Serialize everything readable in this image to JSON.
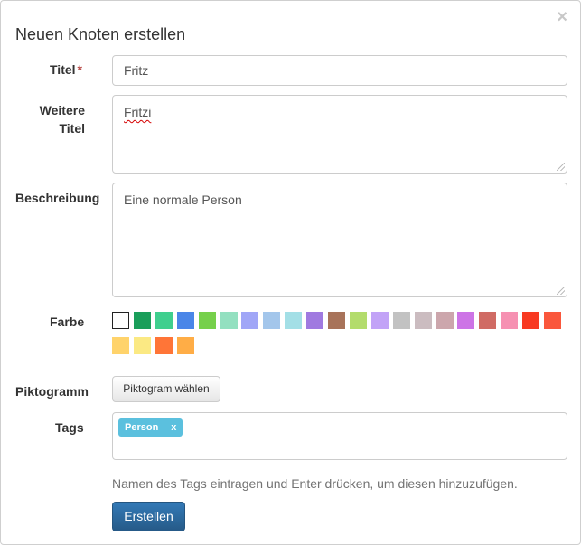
{
  "dialog": {
    "title": "Neuen Knoten erstellen",
    "close_symbol": "×"
  },
  "fields": {
    "title": {
      "label": "Titel",
      "required_marker": "*",
      "value": "Fritz"
    },
    "alt_titles": {
      "label_line1": "Weitere",
      "label_line2": "Titel",
      "value": "Fritzi"
    },
    "description": {
      "label": "Beschreibung",
      "value": "Eine normale Person"
    },
    "color": {
      "label": "Farbe",
      "swatches": [
        "#ffffff",
        "#1a9e5a",
        "#3fcf8e",
        "#4a86e8",
        "#76d04b",
        "#93e0c0",
        "#a0a6f7",
        "#a3c6eb",
        "#a3dfe6",
        "#a07ae0",
        "#a8735a",
        "#b3dc6c",
        "#c2a3f7",
        "#c2c2c2",
        "#cbbcc0",
        "#cca6ac",
        "#cd74e6",
        "#d06b64",
        "#f691b2",
        "#f83a22",
        "#fa573c",
        "#ffd36b",
        "#fbe983",
        "#ff7537",
        "#ffad46"
      ],
      "selected_index": 0
    },
    "pictogram": {
      "label": "Piktogramm",
      "button_label": "Piktogram wählen"
    },
    "tags": {
      "label": "Tags",
      "items": [
        {
          "name": "Person",
          "remove": "x"
        }
      ],
      "help_text": "Namen des Tags eintragen und Enter drücken, um diesen hinzuzufügen."
    }
  },
  "submit": {
    "label": "Erstellen"
  }
}
